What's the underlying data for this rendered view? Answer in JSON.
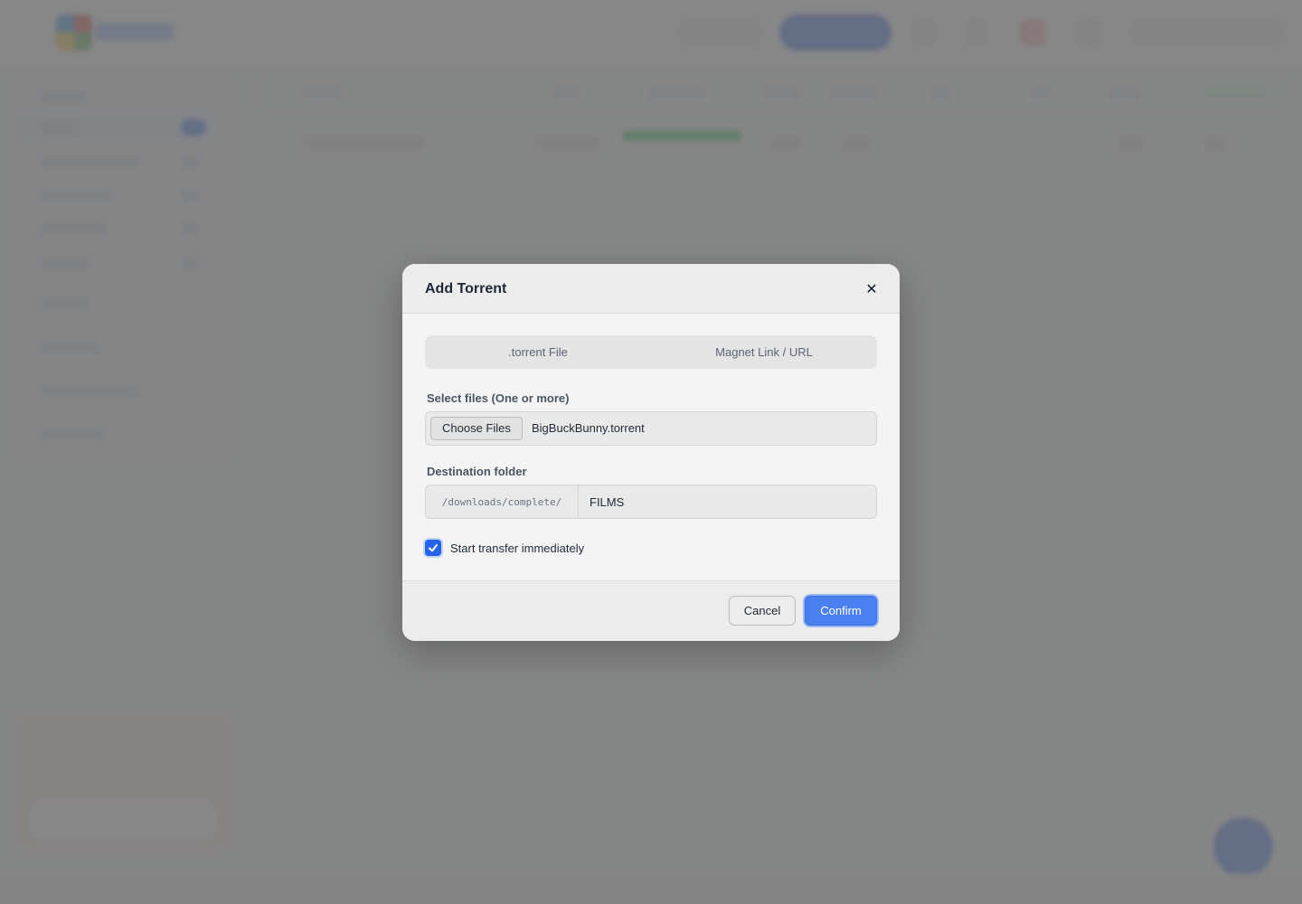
{
  "colors": {
    "accent": "#4a7ff0",
    "overlay": "#707070",
    "modal_bg": "#f4f4f4",
    "success": "#22c55e"
  },
  "background_app": {
    "active_torrent_progress": 1.0
  },
  "modal": {
    "title": "Add Torrent",
    "close_icon": "close-icon",
    "tabs": [
      {
        "label": ".torrent File"
      },
      {
        "label": "Magnet Link / URL"
      }
    ],
    "files": {
      "label": "Select files (One or more)",
      "button_label": "Choose Files",
      "selected_file": "BigBuckBunny.torrent"
    },
    "destination": {
      "label": "Destination folder",
      "prefix": "/downloads/complete/",
      "value": "FILMS"
    },
    "start_immediately": {
      "label": "Start transfer immediately",
      "checked": true
    },
    "footer": {
      "cancel_label": "Cancel",
      "confirm_label": "Confirm"
    }
  }
}
